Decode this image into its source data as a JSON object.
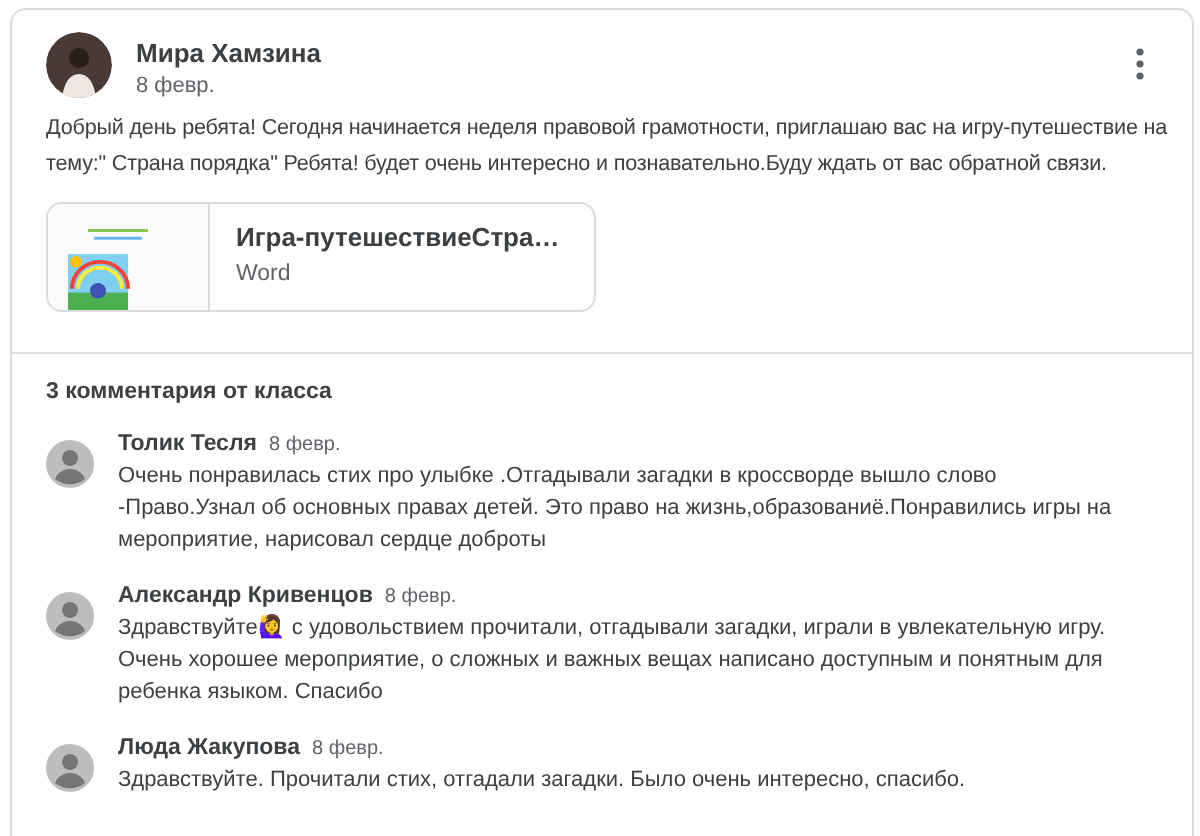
{
  "post": {
    "author": "Мира Хамзина",
    "date": "8 февр.",
    "text": "Добрый день ребята! Сегодня начинается неделя правовой грамотности, приглашаю вас на игру-путешествие на тему:\" Страна порядка\" Ребята! будет очень интересно и познавательно.Буду ждать от вас обратной связи.",
    "attachment": {
      "title": "Игра-путешествиеСтра…",
      "type": "Word"
    }
  },
  "comments_header": "3 комментария от класса",
  "comments": [
    {
      "author": "Толик Тесля",
      "date": "8 февр.",
      "text": "Очень понравилась стих про улыбке .Отгадывали загадки в кроссворде вышло слово -Право.Узнал об основных правах детей. Это право на жизнь,образованиё.Понравились игры на мероприятие, нарисовал сердце доброты"
    },
    {
      "author": "Александр Кривенцов",
      "date": "8 февр.",
      "text": "Здравствуйте🙋‍♀️ с удовольствием прочитали, отгадывали загадки, играли в увлекательную игру. Очень хорошее мероприятие, о сложных и важных вещах написано доступным и понятным для ребенка языком. Спасибо"
    },
    {
      "author": "Люда Жакупова",
      "date": "8 февр.",
      "text": "Здравствуйте. Прочитали стих,  отгадали загадки. Было очень интересно, спасибо."
    }
  ]
}
